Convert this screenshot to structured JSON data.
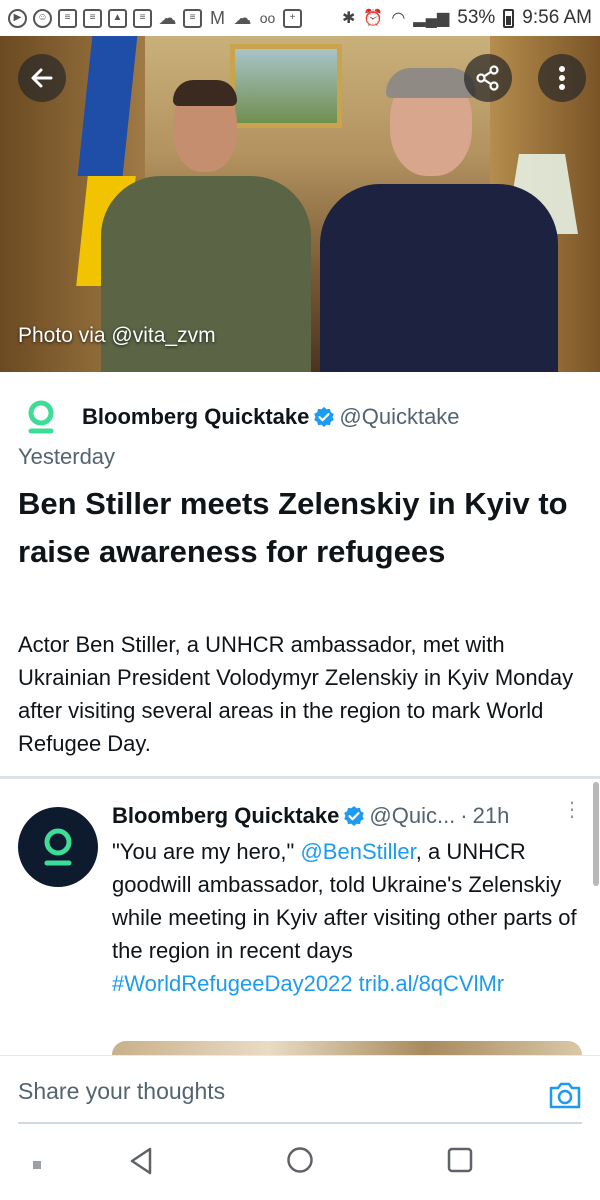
{
  "status_bar": {
    "battery": "53%",
    "time": "9:56 AM",
    "notification_icons": [
      "play-icon",
      "smiley-icon",
      "news-icon",
      "news-icon",
      "image-icon",
      "news-icon",
      "cloud-icon",
      "news-icon",
      "gmail-icon",
      "cloud-icon",
      "voicemail-icon",
      "plus-icon"
    ]
  },
  "hero": {
    "photo_credit": "Photo via @vita_zvm"
  },
  "article": {
    "source_name": "Bloomberg Quicktake",
    "source_handle": "@Quicktake",
    "timestamp": "Yesterday",
    "headline": "Ben Stiller meets Zelenskiy in Kyiv to raise awareness for refugees",
    "summary": "Actor Ben Stiller, a UNHCR ambassador, met with Ukrainian President Volodymyr Zelenskiy in Kyiv Monday after visiting several areas in the region to mark World Refugee Day."
  },
  "tweet": {
    "author_name": "Bloomberg Quicktake",
    "author_handle": "@Quic...",
    "separator": "·",
    "age": "21h",
    "text_part1": "\"You are my hero,\" ",
    "mention": "@BenStiller",
    "text_part2": ", a UNHCR goodwill ambassador, told Ukraine's Zelenskiy while meeting in Kyiv after visiting other parts of the region in recent days ",
    "hashtag": "#WorldRefugeeDay2022",
    "link": "trib.al/8qCVlMr"
  },
  "compose": {
    "placeholder": "Share your thoughts"
  },
  "colors": {
    "link": "#1d9bf0",
    "secondary_text": "#536471",
    "verified": "#1d9bf0",
    "quicktake_green": "#3ddc97"
  }
}
